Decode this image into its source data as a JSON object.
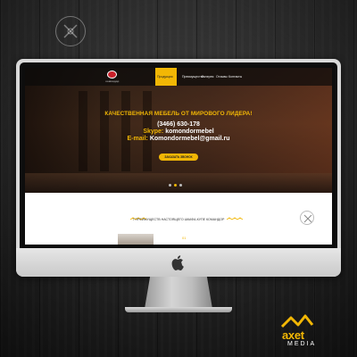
{
  "site": {
    "brand_name": "комондор",
    "nav": {
      "items": [
        {
          "label": "Продукция",
          "active": true
        },
        {
          "label": "Преимущества",
          "active": false
        },
        {
          "label": "Галерея",
          "active": false
        },
        {
          "label": "Отзывы",
          "active": false
        },
        {
          "label": "Контакты",
          "active": false
        }
      ],
      "phone": "(3466) 630-178"
    },
    "hero": {
      "headline": "КАЧЕСТВЕННАЯ МЕБЕЛЬ ОТ МИРОВОГО ЛИДЕРА!",
      "phone": "(3466) 630-178",
      "skype_label": "Skype:",
      "skype_value": "komondormebel",
      "email_label": "E-mail:",
      "email_value": "Komondormebel@gmail.ru",
      "cta_label": "ЗАКАЗАТЬ ЗВОНОК",
      "slider_active_index": 1
    },
    "section": {
      "title": "7 ПРЕИМУЩЕСТВ НАСТОЯЩЕГО ШКАФА-КУПЕ КОМАНДОР",
      "number": "01"
    }
  },
  "watermark": {
    "brand": "axet",
    "sub": "MEDIA"
  },
  "colors": {
    "accent": "#f2b705",
    "brand_red": "#c8202a"
  }
}
